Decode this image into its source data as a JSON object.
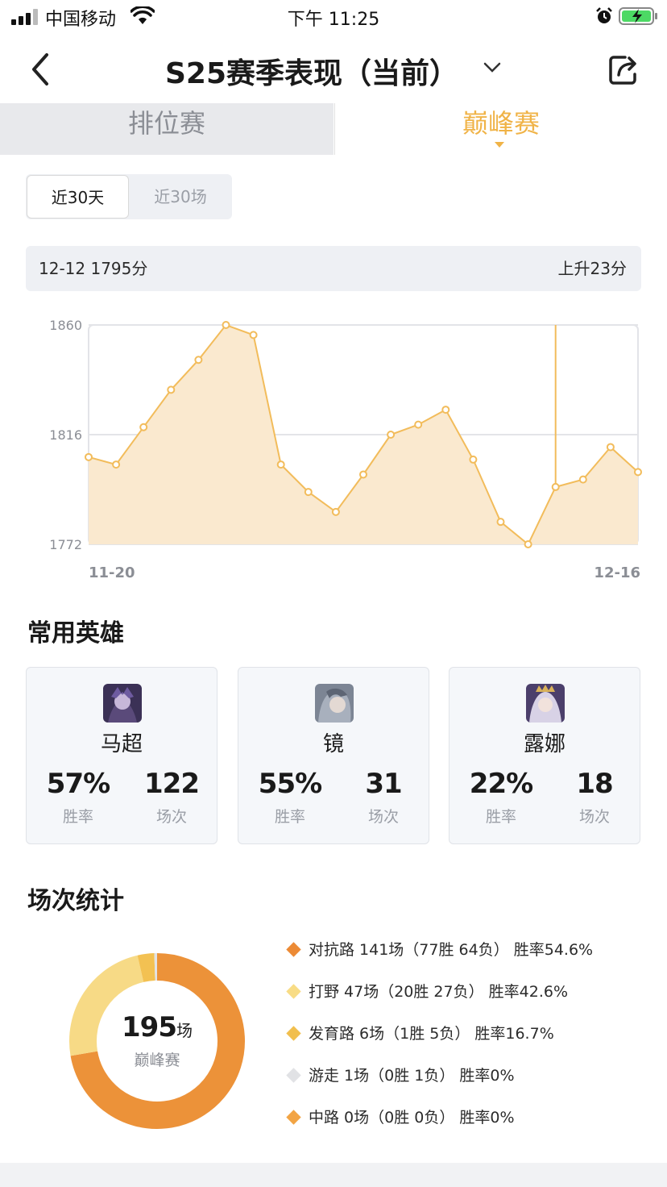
{
  "status_bar": {
    "carrier": "中国移动",
    "time": "下午 11:25"
  },
  "nav": {
    "title": "S25赛季表现（当前）"
  },
  "tabs": [
    {
      "label": "排位赛",
      "active": false
    },
    {
      "label": "巅峰赛",
      "active": true
    }
  ],
  "range_toggle": {
    "options": [
      "近30天",
      "近30场"
    ],
    "selected": "近30天"
  },
  "info": {
    "left": "12-12 1795分",
    "right": "上升23分"
  },
  "chart_data": {
    "type": "area",
    "x_labels": [
      "11-20",
      "12-16"
    ],
    "y_ticks": [
      1772,
      1816,
      1860
    ],
    "ylim": [
      1772,
      1860
    ],
    "values": [
      1807,
      1804,
      1819,
      1834,
      1846,
      1860,
      1856,
      1804,
      1793,
      1785,
      1800,
      1816,
      1820,
      1826,
      1806,
      1781,
      1772,
      1795,
      1798,
      1811,
      1801
    ],
    "highlight_index": 17,
    "grid": true,
    "colors": {
      "line": "#f2bc5b",
      "fill": "#fae9cf",
      "grid": "#e3e4e8"
    }
  },
  "heroes_section": {
    "title": "常用英雄",
    "heroes": [
      {
        "name": "马超",
        "win_rate": "57%",
        "win_label": "胜率",
        "games": "122",
        "games_label": "场次",
        "avatar_color": "#3b3156"
      },
      {
        "name": "镜",
        "win_rate": "55%",
        "win_label": "胜率",
        "games": "31",
        "games_label": "场次",
        "avatar_color": "#7c8594"
      },
      {
        "name": "露娜",
        "win_rate": "22%",
        "win_label": "胜率",
        "games": "18",
        "games_label": "场次",
        "avatar_color": "#4b3f6b"
      }
    ]
  },
  "stats_section": {
    "title": "场次统计",
    "total": "195",
    "total_unit": "场",
    "mode": "巅峰赛",
    "donut": [
      {
        "name": "对抗路",
        "games": 141,
        "color": "#ec9239"
      },
      {
        "name": "打野",
        "games": 47,
        "color": "#f7da86"
      },
      {
        "name": "发育路",
        "games": 6,
        "color": "#f3c152"
      },
      {
        "name": "游走",
        "games": 1,
        "color": "#e2e3e6"
      },
      {
        "name": "中路",
        "games": 0,
        "color": "#f3a74b"
      }
    ],
    "legend": [
      {
        "text": "对抗路 141场（77胜 64负） 胜率54.6%",
        "color": "#ec8a35"
      },
      {
        "text": "打野 47场（20胜 27负） 胜率42.6%",
        "color": "#f8dc85"
      },
      {
        "text": "发育路 6场（1胜 5负） 胜率16.7%",
        "color": "#f1bf4e"
      },
      {
        "text": "游走 1场（0胜 1负） 胜率0%",
        "color": "#e1e2e5"
      },
      {
        "text": "中路 0场（0胜 0负） 胜率0%",
        "color": "#f2a444"
      }
    ]
  }
}
